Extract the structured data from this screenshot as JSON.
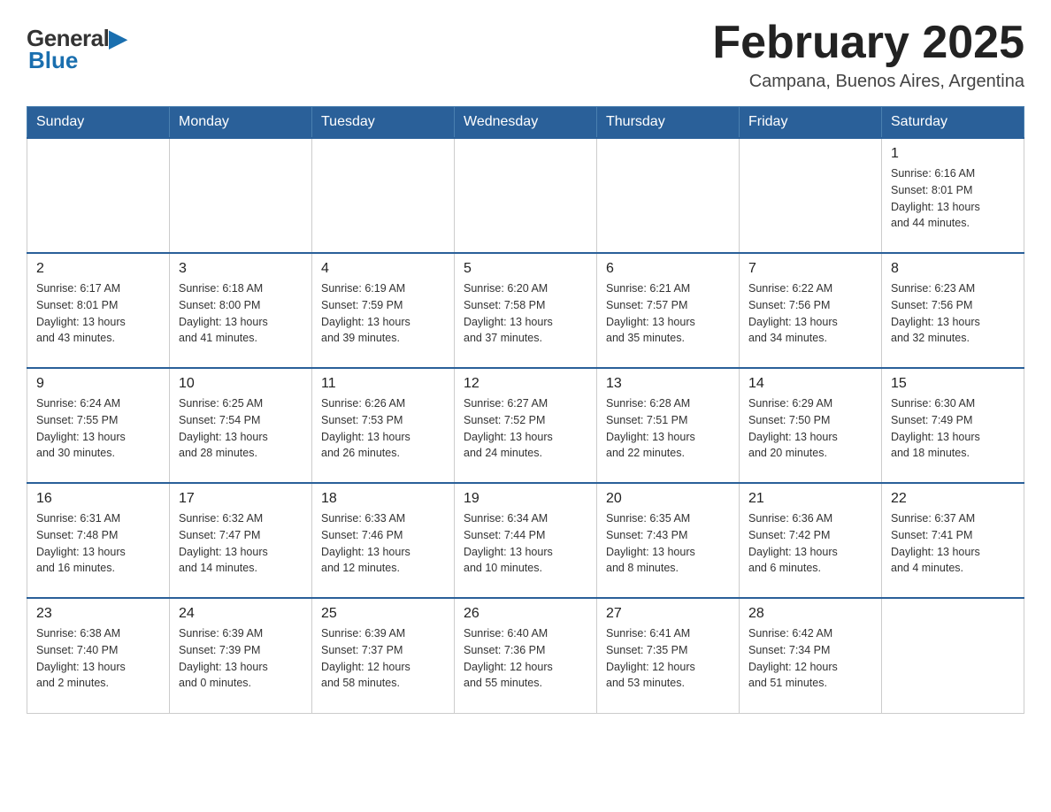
{
  "logo": {
    "general": "General",
    "triangle": "▲",
    "blue": "Blue"
  },
  "title": "February 2025",
  "location": "Campana, Buenos Aires, Argentina",
  "weekdays": [
    "Sunday",
    "Monday",
    "Tuesday",
    "Wednesday",
    "Thursday",
    "Friday",
    "Saturday"
  ],
  "weeks": [
    [
      {
        "day": "",
        "info": ""
      },
      {
        "day": "",
        "info": ""
      },
      {
        "day": "",
        "info": ""
      },
      {
        "day": "",
        "info": ""
      },
      {
        "day": "",
        "info": ""
      },
      {
        "day": "",
        "info": ""
      },
      {
        "day": "1",
        "info": "Sunrise: 6:16 AM\nSunset: 8:01 PM\nDaylight: 13 hours\nand 44 minutes."
      }
    ],
    [
      {
        "day": "2",
        "info": "Sunrise: 6:17 AM\nSunset: 8:01 PM\nDaylight: 13 hours\nand 43 minutes."
      },
      {
        "day": "3",
        "info": "Sunrise: 6:18 AM\nSunset: 8:00 PM\nDaylight: 13 hours\nand 41 minutes."
      },
      {
        "day": "4",
        "info": "Sunrise: 6:19 AM\nSunset: 7:59 PM\nDaylight: 13 hours\nand 39 minutes."
      },
      {
        "day": "5",
        "info": "Sunrise: 6:20 AM\nSunset: 7:58 PM\nDaylight: 13 hours\nand 37 minutes."
      },
      {
        "day": "6",
        "info": "Sunrise: 6:21 AM\nSunset: 7:57 PM\nDaylight: 13 hours\nand 35 minutes."
      },
      {
        "day": "7",
        "info": "Sunrise: 6:22 AM\nSunset: 7:56 PM\nDaylight: 13 hours\nand 34 minutes."
      },
      {
        "day": "8",
        "info": "Sunrise: 6:23 AM\nSunset: 7:56 PM\nDaylight: 13 hours\nand 32 minutes."
      }
    ],
    [
      {
        "day": "9",
        "info": "Sunrise: 6:24 AM\nSunset: 7:55 PM\nDaylight: 13 hours\nand 30 minutes."
      },
      {
        "day": "10",
        "info": "Sunrise: 6:25 AM\nSunset: 7:54 PM\nDaylight: 13 hours\nand 28 minutes."
      },
      {
        "day": "11",
        "info": "Sunrise: 6:26 AM\nSunset: 7:53 PM\nDaylight: 13 hours\nand 26 minutes."
      },
      {
        "day": "12",
        "info": "Sunrise: 6:27 AM\nSunset: 7:52 PM\nDaylight: 13 hours\nand 24 minutes."
      },
      {
        "day": "13",
        "info": "Sunrise: 6:28 AM\nSunset: 7:51 PM\nDaylight: 13 hours\nand 22 minutes."
      },
      {
        "day": "14",
        "info": "Sunrise: 6:29 AM\nSunset: 7:50 PM\nDaylight: 13 hours\nand 20 minutes."
      },
      {
        "day": "15",
        "info": "Sunrise: 6:30 AM\nSunset: 7:49 PM\nDaylight: 13 hours\nand 18 minutes."
      }
    ],
    [
      {
        "day": "16",
        "info": "Sunrise: 6:31 AM\nSunset: 7:48 PM\nDaylight: 13 hours\nand 16 minutes."
      },
      {
        "day": "17",
        "info": "Sunrise: 6:32 AM\nSunset: 7:47 PM\nDaylight: 13 hours\nand 14 minutes."
      },
      {
        "day": "18",
        "info": "Sunrise: 6:33 AM\nSunset: 7:46 PM\nDaylight: 13 hours\nand 12 minutes."
      },
      {
        "day": "19",
        "info": "Sunrise: 6:34 AM\nSunset: 7:44 PM\nDaylight: 13 hours\nand 10 minutes."
      },
      {
        "day": "20",
        "info": "Sunrise: 6:35 AM\nSunset: 7:43 PM\nDaylight: 13 hours\nand 8 minutes."
      },
      {
        "day": "21",
        "info": "Sunrise: 6:36 AM\nSunset: 7:42 PM\nDaylight: 13 hours\nand 6 minutes."
      },
      {
        "day": "22",
        "info": "Sunrise: 6:37 AM\nSunset: 7:41 PM\nDaylight: 13 hours\nand 4 minutes."
      }
    ],
    [
      {
        "day": "23",
        "info": "Sunrise: 6:38 AM\nSunset: 7:40 PM\nDaylight: 13 hours\nand 2 minutes."
      },
      {
        "day": "24",
        "info": "Sunrise: 6:39 AM\nSunset: 7:39 PM\nDaylight: 13 hours\nand 0 minutes."
      },
      {
        "day": "25",
        "info": "Sunrise: 6:39 AM\nSunset: 7:37 PM\nDaylight: 12 hours\nand 58 minutes."
      },
      {
        "day": "26",
        "info": "Sunrise: 6:40 AM\nSunset: 7:36 PM\nDaylight: 12 hours\nand 55 minutes."
      },
      {
        "day": "27",
        "info": "Sunrise: 6:41 AM\nSunset: 7:35 PM\nDaylight: 12 hours\nand 53 minutes."
      },
      {
        "day": "28",
        "info": "Sunrise: 6:42 AM\nSunset: 7:34 PM\nDaylight: 12 hours\nand 51 minutes."
      },
      {
        "day": "",
        "info": ""
      }
    ]
  ]
}
